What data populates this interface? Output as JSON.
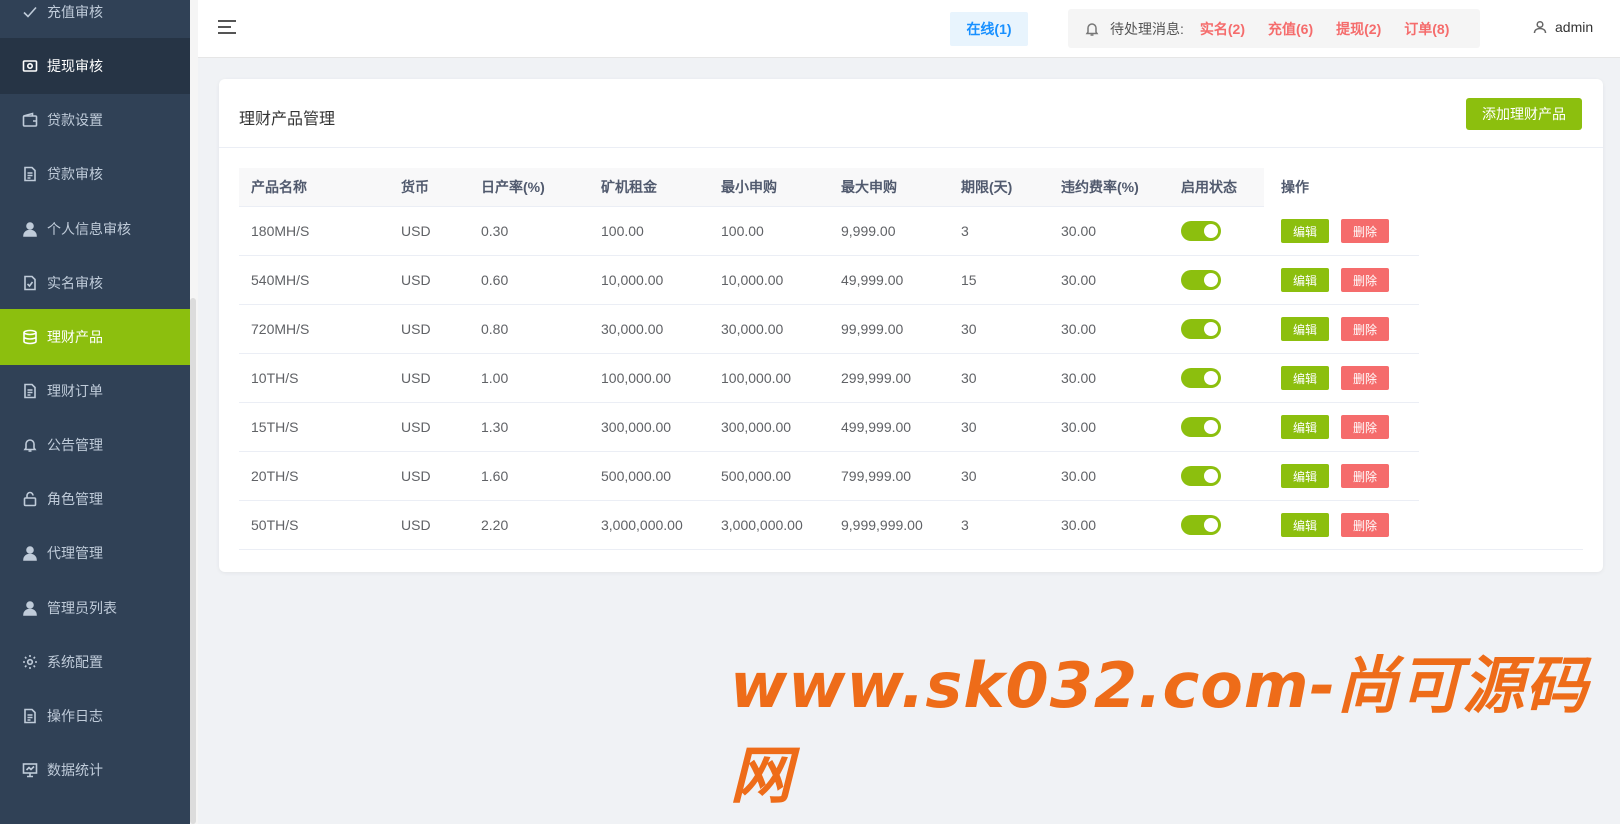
{
  "sidebar": {
    "items": [
      {
        "label": "充值审核",
        "icon": "check-icon"
      },
      {
        "label": "提现审核",
        "icon": "cash-icon"
      },
      {
        "label": "贷款设置",
        "icon": "wallet-icon"
      },
      {
        "label": "贷款审核",
        "icon": "document-icon"
      },
      {
        "label": "个人信息审核",
        "icon": "user-icon"
      },
      {
        "label": "实名审核",
        "icon": "document-check-icon"
      },
      {
        "label": "理财产品",
        "icon": "database-icon"
      },
      {
        "label": "理财订单",
        "icon": "document-icon"
      },
      {
        "label": "公告管理",
        "icon": "bell-icon"
      },
      {
        "label": "角色管理",
        "icon": "lock-icon"
      },
      {
        "label": "代理管理",
        "icon": "user-icon"
      },
      {
        "label": "管理员列表",
        "icon": "user-icon"
      },
      {
        "label": "系统配置",
        "icon": "gear-icon"
      },
      {
        "label": "操作日志",
        "icon": "document-icon"
      },
      {
        "label": "数据统计",
        "icon": "presentation-icon"
      }
    ]
  },
  "header": {
    "online": "在线(1)",
    "notice_label": "待处理消息:",
    "notices": [
      "实名(2)",
      "充值(6)",
      "提现(2)",
      "订单(8)"
    ],
    "user": "admin"
  },
  "card": {
    "title": "理财产品管理",
    "add_button": "添加理财产品"
  },
  "table": {
    "columns": [
      "产品名称",
      "货币",
      "日产率(%)",
      "矿机租金",
      "最小申购",
      "最大申购",
      "期限(天)",
      "违约费率(%)",
      "启用状态",
      "操作"
    ],
    "edit_label": "编辑",
    "delete_label": "删除",
    "rows": [
      [
        "180MH/S",
        "USD",
        "0.30",
        "100.00",
        "100.00",
        "9,999.00",
        "3",
        "30.00"
      ],
      [
        "540MH/S",
        "USD",
        "0.60",
        "10,000.00",
        "10,000.00",
        "49,999.00",
        "15",
        "30.00"
      ],
      [
        "720MH/S",
        "USD",
        "0.80",
        "30,000.00",
        "30,000.00",
        "99,999.00",
        "30",
        "30.00"
      ],
      [
        "10TH/S",
        "USD",
        "1.00",
        "100,000.00",
        "100,000.00",
        "299,999.00",
        "30",
        "30.00"
      ],
      [
        "15TH/S",
        "USD",
        "1.30",
        "300,000.00",
        "300,000.00",
        "499,999.00",
        "30",
        "30.00"
      ],
      [
        "20TH/S",
        "USD",
        "1.60",
        "500,000.00",
        "500,000.00",
        "799,999.00",
        "30",
        "30.00"
      ],
      [
        "50TH/S",
        "USD",
        "2.20",
        "3,000,000.00",
        "3,000,000.00",
        "9,999,999.00",
        "3",
        "30.00"
      ]
    ]
  },
  "watermark": "www.sk032.com-尚可源码网",
  "colors": {
    "accent": "#8cbf0e",
    "danger": "#f56c6c",
    "sidebar": "#304156",
    "link": "#1890ff"
  }
}
